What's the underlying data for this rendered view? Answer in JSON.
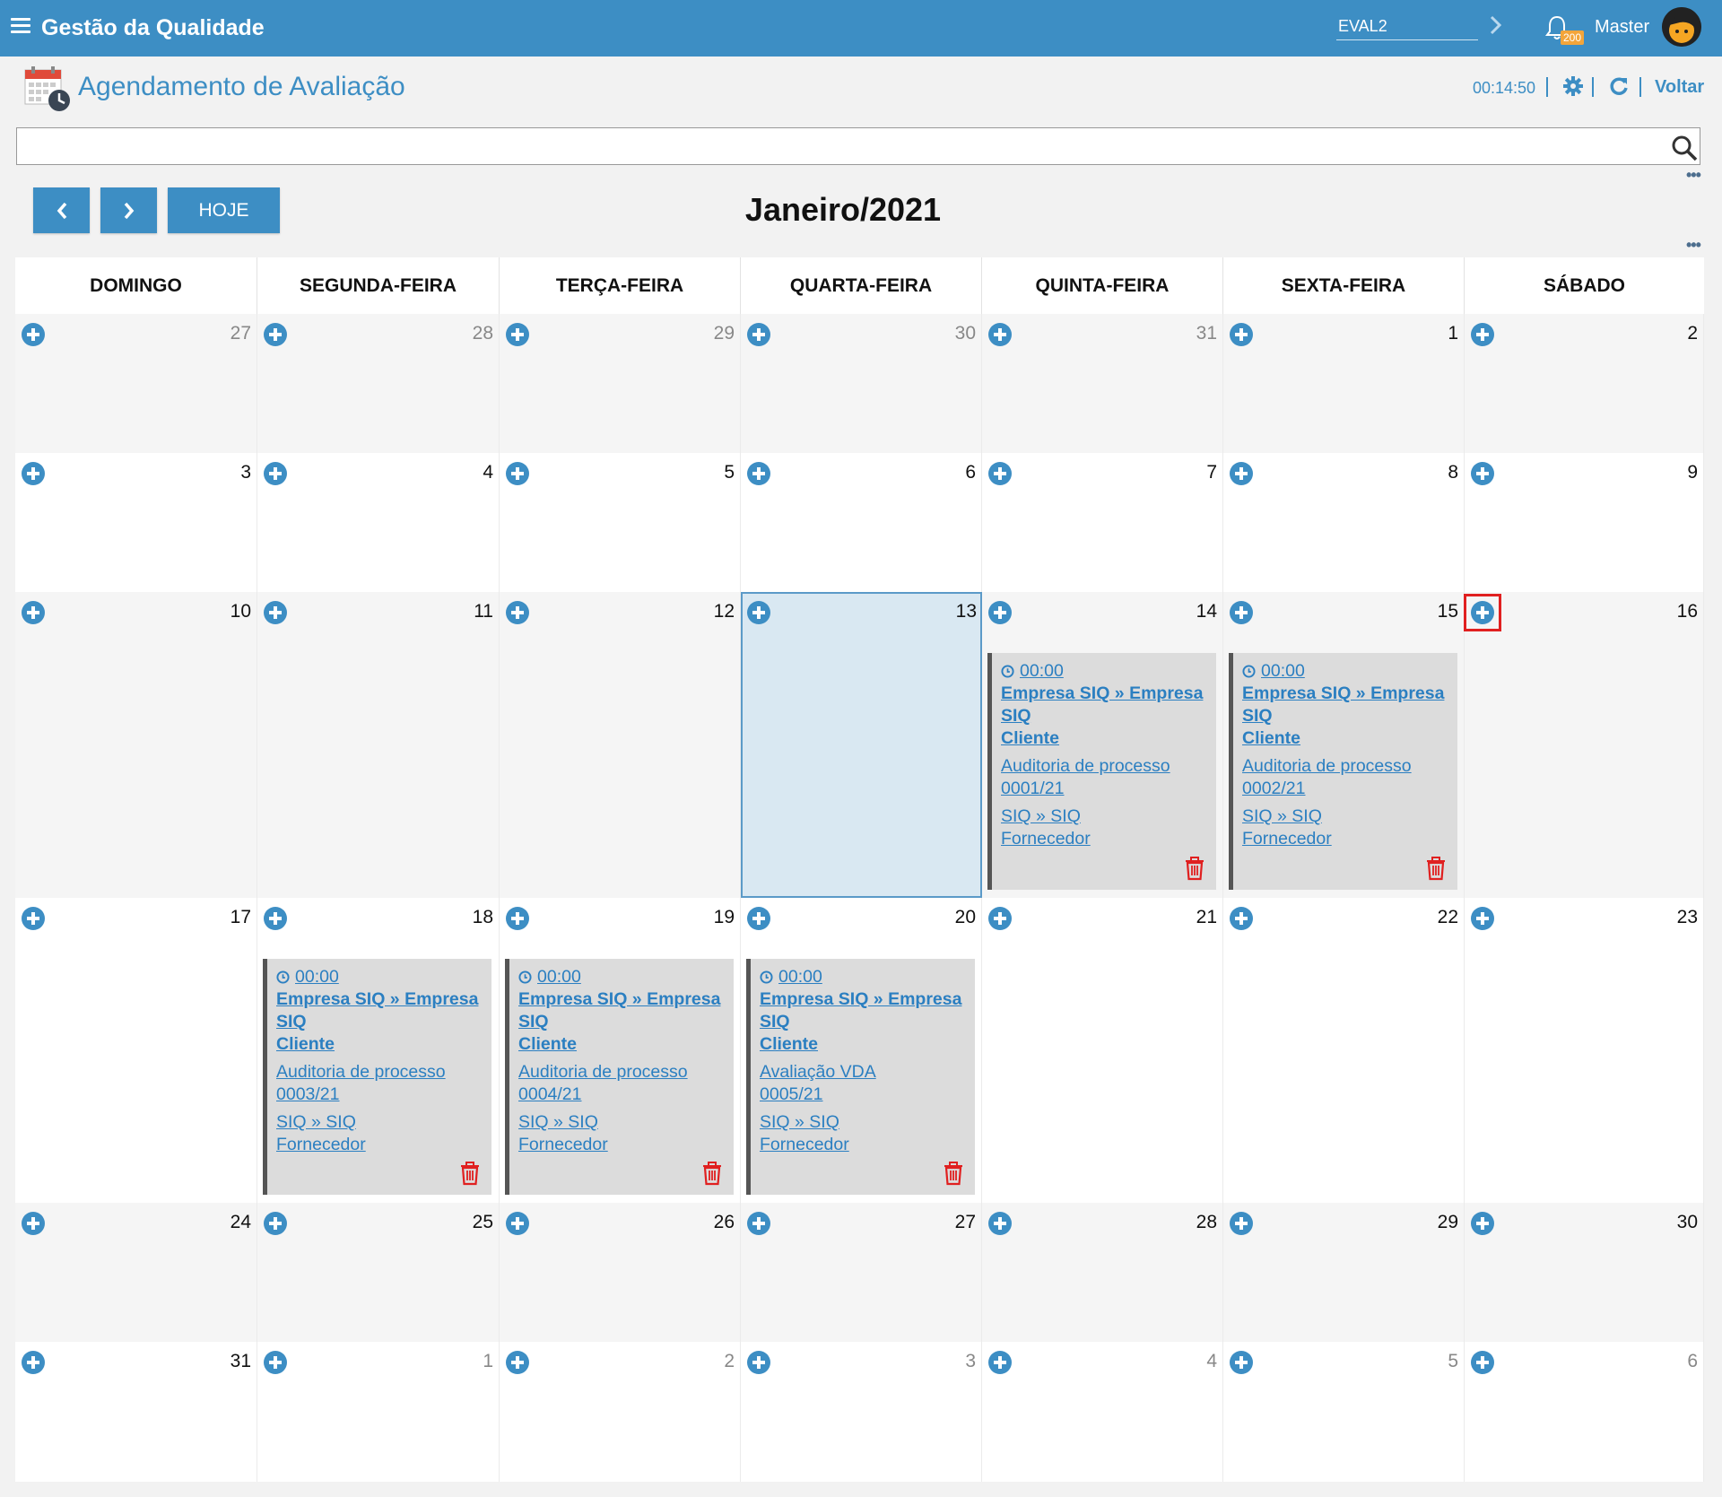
{
  "topbar": {
    "app_title": "Gestão da Qualidade",
    "environment": "EVAL2",
    "notification_count": "200",
    "user_name": "Master"
  },
  "page": {
    "title": "Agendamento de Avaliação",
    "timer": "00:14:50",
    "back_label": "Voltar"
  },
  "search": {
    "value": "",
    "placeholder": ""
  },
  "toolbar": {
    "today_label": "HOJE",
    "prev_label": "<",
    "next_label": ">"
  },
  "calendar": {
    "month_title": "Janeiro/2021",
    "weekdays": [
      "DOMINGO",
      "SEGUNDA-FEIRA",
      "TERÇA-FEIRA",
      "QUARTA-FEIRA",
      "QUINTA-FEIRA",
      "SEXTA-FEIRA",
      "SÁBADO"
    ],
    "weeks": [
      [
        "27",
        "28",
        "29",
        "30",
        "31",
        "1",
        "2"
      ],
      [
        "3",
        "4",
        "5",
        "6",
        "7",
        "8",
        "9"
      ],
      [
        "10",
        "11",
        "12",
        "13",
        "14",
        "15",
        "16"
      ],
      [
        "17",
        "18",
        "19",
        "20",
        "21",
        "22",
        "23"
      ],
      [
        "24",
        "25",
        "26",
        "27",
        "28",
        "29",
        "30"
      ],
      [
        "31",
        "1",
        "2",
        "3",
        "4",
        "5",
        "6"
      ]
    ],
    "today": "13",
    "events": [
      {
        "day": "14",
        "time": "00:00",
        "company_line1": "Empresa SIQ » Empresa",
        "company_line2": "SIQ",
        "party": "Cliente",
        "process_line1": "Auditoria de processo",
        "process_line2": "0001/21",
        "location_line1": "SIQ » SIQ",
        "location_line2": "Fornecedor"
      },
      {
        "day": "15",
        "time": "00:00",
        "company_line1": "Empresa SIQ » Empresa",
        "company_line2": "SIQ",
        "party": "Cliente",
        "process_line1": "Auditoria de processo",
        "process_line2": "0002/21",
        "location_line1": "SIQ » SIQ",
        "location_line2": "Fornecedor"
      },
      {
        "day": "18",
        "time": "00:00",
        "company_line1": "Empresa SIQ » Empresa",
        "company_line2": "SIQ",
        "party": "Cliente",
        "process_line1": "Auditoria de processo",
        "process_line2": "0003/21",
        "location_line1": "SIQ » SIQ",
        "location_line2": "Fornecedor"
      },
      {
        "day": "19",
        "time": "00:00",
        "company_line1": "Empresa SIQ » Empresa",
        "company_line2": "SIQ",
        "party": "Cliente",
        "process_line1": "Auditoria de processo",
        "process_line2": "0004/21",
        "location_line1": "SIQ » SIQ",
        "location_line2": "Fornecedor"
      },
      {
        "day": "20",
        "time": "00:00",
        "company_line1": "Empresa SIQ » Empresa",
        "company_line2": "SIQ",
        "party": "Cliente",
        "process_line1": "Avaliação VDA",
        "process_line2": "0005/21",
        "location_line1": "SIQ » SIQ",
        "location_line2": "Fornecedor"
      }
    ]
  },
  "colors": {
    "brand": "#3d8ec4",
    "link": "#2b7fc1",
    "delete": "#e02020",
    "today_bg": "#d9e8f2",
    "event_bg": "#dcdcdc"
  }
}
